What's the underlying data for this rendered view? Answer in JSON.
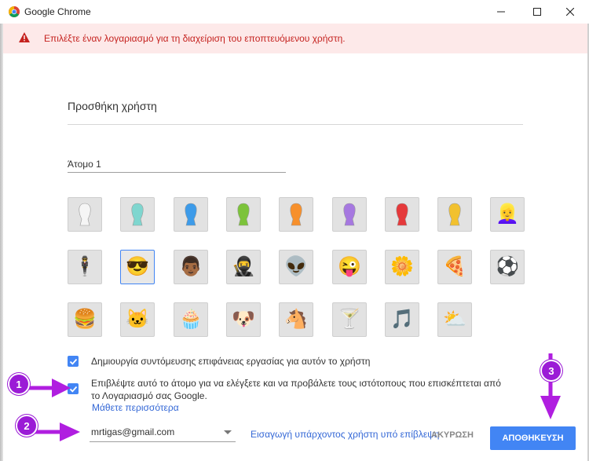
{
  "window": {
    "title": "Google Chrome",
    "minimize_icon": "minimize-icon",
    "maximize_icon": "maximize-icon",
    "close_icon": "close-icon"
  },
  "banner": {
    "icon": "warning-icon",
    "text": "Επιλέξτε έναν λογαριασμό για τη διαχείριση του εποπτευόμενου χρήστη.",
    "color": "#c5221f"
  },
  "dialog": {
    "heading": "Προσθήκη χρήστη",
    "name_value": "Άτομο 1",
    "avatars": [
      "avatar-white-silhouette",
      "avatar-teal-silhouette",
      "avatar-blue-silhouette",
      "avatar-green-silhouette",
      "avatar-orange-silhouette",
      "avatar-purple-silhouette",
      "avatar-red-silhouette",
      "avatar-yellow-silhouette",
      "avatar-blonde-woman",
      "avatar-businessman",
      "avatar-woman-sunglasses",
      "avatar-man-dark-hair",
      "avatar-ninja",
      "avatar-alien",
      "avatar-smiley",
      "avatar-flower",
      "avatar-pizza",
      "avatar-soccer-ball",
      "avatar-burger",
      "avatar-cat",
      "avatar-cupcake",
      "avatar-dog",
      "avatar-horse",
      "avatar-cocktail",
      "avatar-music-note",
      "avatar-sun-cloud"
    ],
    "selected_avatar": "avatar-woman-sunglasses",
    "checkbox_shortcut": {
      "checked": true,
      "label": "Δημιουργία συντόμευσης επιφάνειας εργασίας για αυτόν το χρήστη"
    },
    "checkbox_supervise": {
      "checked": true,
      "label_line1": "Επιβλέψτε αυτό το άτομο για να ελέγξετε και να προβάλετε τους ιστότοπους που επισκέπτεται από",
      "label_line2": "το Λογαριασμό σας Google."
    },
    "learn_more": "Μάθετε περισσότερα",
    "account_select_value": "mrtigas@gmail.com",
    "import_link": "Εισαγωγή υπάρχοντος χρήστη υπό επίβλεψη",
    "cancel_label": "ΑΚΥΡΩΣΗ",
    "save_label": "ΑΠΟΘΗΚΕΥΣΗ"
  },
  "annotations": {
    "marker1": "1",
    "marker2": "2",
    "marker3": "3",
    "color": "#9b1bd6"
  }
}
